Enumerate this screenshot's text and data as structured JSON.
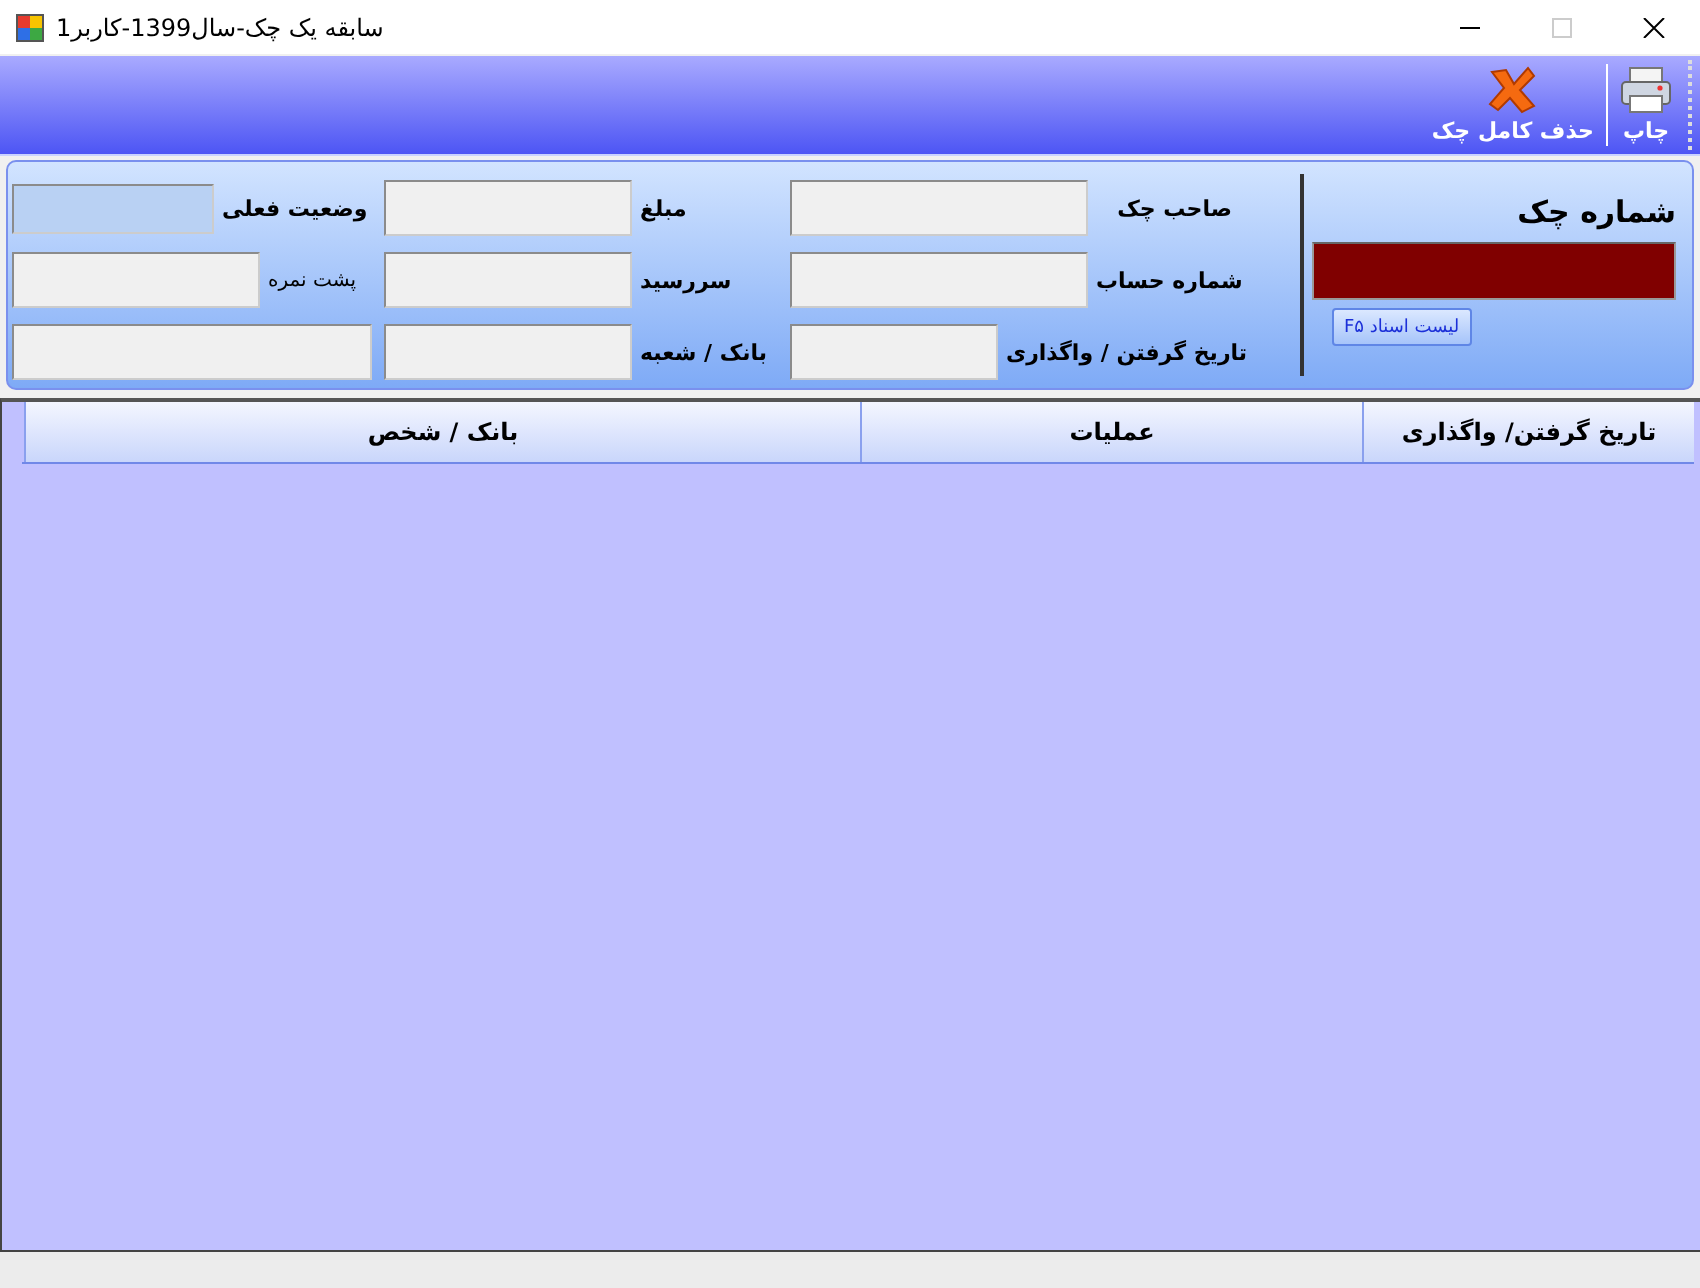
{
  "window": {
    "title": "سابقه یک چک-سال1399-کاربر1"
  },
  "toolbar": [
    {
      "kind": "print",
      "label": "چاپ"
    },
    {
      "kind": "delete",
      "label": "حذف کامل چک"
    }
  ],
  "check_number": {
    "title": "شماره چک",
    "button": "لیست اسناد F۵"
  },
  "form_rows": [
    [
      {
        "kind": "labeled",
        "label": "صاحب چک",
        "readonly": false
      },
      {
        "kind": "labeled",
        "label": "مبلغ",
        "readonly": false
      },
      {
        "kind": "labeled",
        "label": "وضعیت فعلی",
        "readonly": true
      }
    ],
    [
      {
        "kind": "labeled",
        "label": "شماره حساب",
        "readonly": false
      },
      {
        "kind": "labeled",
        "label": "سررسید",
        "readonly": false
      },
      {
        "kind": "small",
        "label": "پشت نمره",
        "readonly": false
      }
    ],
    [
      {
        "kind": "labeled",
        "label": "تاریخ گرفتن / واگذاری",
        "readonly": false
      },
      {
        "kind": "labeled",
        "label": "بانک / شعبه",
        "readonly": false
      },
      {
        "kind": "field",
        "readonly": false
      }
    ]
  ],
  "table": {
    "columns": [
      "تاریخ گرفتن/ واگذاری",
      "عملیات",
      "بانک / شخص"
    ]
  }
}
